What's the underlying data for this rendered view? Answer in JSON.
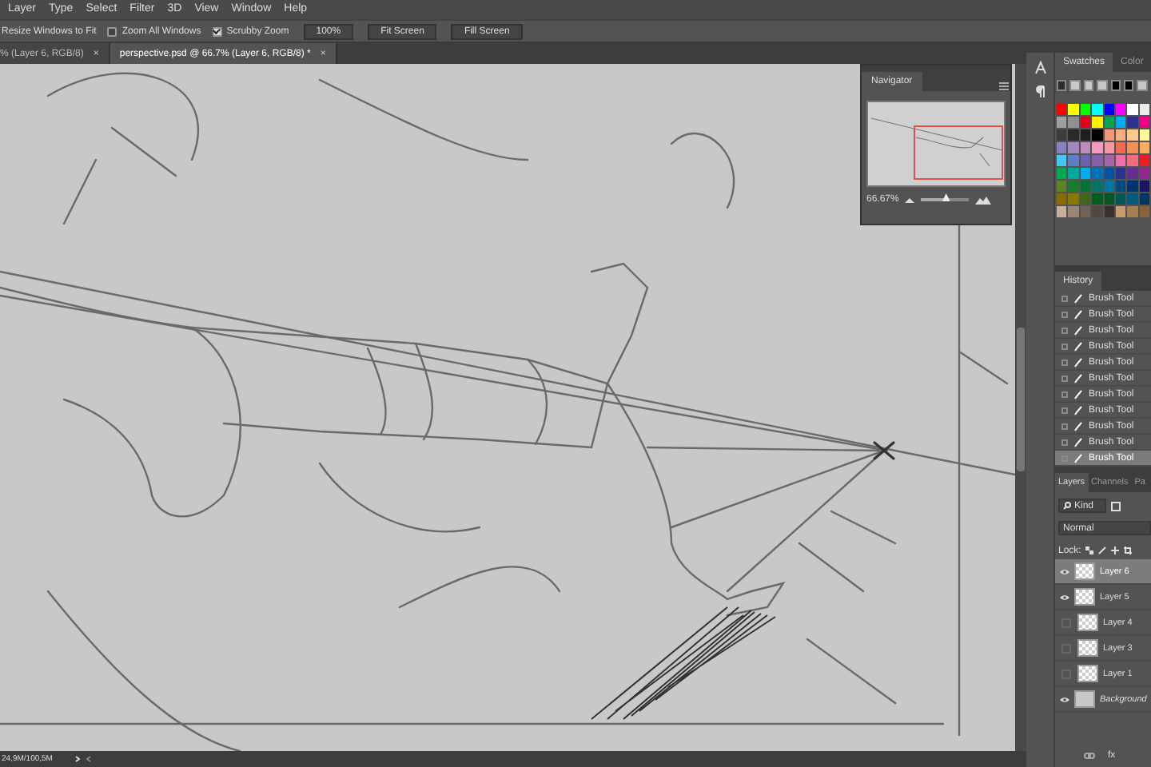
{
  "menu": [
    "Layer",
    "Type",
    "Select",
    "Filter",
    "3D",
    "View",
    "Window",
    "Help"
  ],
  "options": [
    {
      "kind": "label",
      "label": "Resize Windows to Fit"
    },
    {
      "kind": "checkbox",
      "label": "Zoom All Windows",
      "checked": false
    },
    {
      "kind": "checkbox",
      "label": "Scrubby Zoom",
      "checked": true
    },
    {
      "kind": "button",
      "label": "100%"
    },
    {
      "kind": "button",
      "label": "Fit Screen"
    },
    {
      "kind": "button",
      "label": "Fill Screen"
    }
  ],
  "tabs": [
    {
      "label": "% (Layer 6, RGB/8)",
      "close": "×",
      "selected": false
    },
    {
      "label": "perspective.psd @ 66.7% (Layer 6, RGB/8) *",
      "close": "×",
      "selected": true
    }
  ],
  "navigator": {
    "title": "Navigator",
    "zoom": "66.67%",
    "level": 0.5
  },
  "swatches": {
    "tabs": [
      {
        "label": "Swatches",
        "selected": true
      },
      {
        "label": "Color",
        "selected": false
      }
    ],
    "recent": [
      {
        "color": "#2b2b2b"
      },
      {
        "color": "#c8c8c8"
      },
      {
        "color": "#c8c8c8"
      },
      {
        "color": "#c8c8c8"
      },
      {
        "color": "#000000"
      },
      {
        "color": "#000000"
      },
      {
        "color": "#c8c8c8"
      }
    ],
    "grid": [
      [
        {
          "color": "#ff0000"
        },
        {
          "color": "#ffff00"
        },
        {
          "color": "#00ff00"
        },
        {
          "color": "#00ffff"
        },
        {
          "color": "#0000ff"
        },
        {
          "color": "#ff00ff"
        },
        {
          "color": "#ffffff"
        },
        {
          "color": "#ebebeb"
        }
      ],
      [
        {
          "color": "#a0a0a0"
        },
        {
          "color": "#909090"
        },
        {
          "color": "#e2001a"
        },
        {
          "color": "#fff200"
        },
        {
          "color": "#00a651"
        },
        {
          "color": "#00aeef"
        },
        {
          "color": "#2e3192"
        },
        {
          "color": "#ec008c"
        }
      ],
      [
        {
          "color": "#3c3c3c"
        },
        {
          "color": "#2a2a2a"
        },
        {
          "color": "#1e1e1e"
        },
        {
          "color": "#000000"
        },
        {
          "color": "#f7977a"
        },
        {
          "color": "#fbad82"
        },
        {
          "color": "#fdc68c"
        },
        {
          "color": "#fff799"
        }
      ],
      [
        {
          "color": "#8781bd"
        },
        {
          "color": "#a187be"
        },
        {
          "color": "#bc8cbf"
        },
        {
          "color": "#f49ac1"
        },
        {
          "color": "#f6989d"
        },
        {
          "color": "#f26c4f"
        },
        {
          "color": "#f68e56"
        },
        {
          "color": "#fbaf5d"
        }
      ],
      [
        {
          "color": "#44c8f5"
        },
        {
          "color": "#5b7fc2"
        },
        {
          "color": "#6c63b0"
        },
        {
          "color": "#8560a8"
        },
        {
          "color": "#a864a8"
        },
        {
          "color": "#f06eaa"
        },
        {
          "color": "#f26d7d"
        },
        {
          "color": "#ed1c24"
        }
      ],
      [
        {
          "color": "#00a651"
        },
        {
          "color": "#00a99d"
        },
        {
          "color": "#00aeef"
        },
        {
          "color": "#0072bc"
        },
        {
          "color": "#0054a6"
        },
        {
          "color": "#2e3192"
        },
        {
          "color": "#662d91"
        },
        {
          "color": "#92278f"
        }
      ],
      [
        {
          "color": "#598527"
        },
        {
          "color": "#197b30"
        },
        {
          "color": "#007236"
        },
        {
          "color": "#00746b"
        },
        {
          "color": "#0076a3"
        },
        {
          "color": "#004a80"
        },
        {
          "color": "#003471"
        },
        {
          "color": "#1b1464"
        }
      ],
      [
        {
          "color": "#8a6b00"
        },
        {
          "color": "#827b00"
        },
        {
          "color": "#406618"
        },
        {
          "color": "#005e20"
        },
        {
          "color": "#005826"
        },
        {
          "color": "#005952"
        },
        {
          "color": "#005b7f"
        },
        {
          "color": "#003663"
        }
      ],
      [
        {
          "color": "#c7b299"
        },
        {
          "color": "#998675"
        },
        {
          "color": "#736357"
        },
        {
          "color": "#534741"
        },
        {
          "color": "#362f2d"
        },
        {
          "color": "#c69c6d"
        },
        {
          "color": "#a67c52"
        },
        {
          "color": "#8c6239"
        }
      ]
    ]
  },
  "history": {
    "title": "History",
    "items": [
      {
        "label": "Brush Tool",
        "selected": false
      },
      {
        "label": "Brush Tool",
        "selected": false
      },
      {
        "label": "Brush Tool",
        "selected": false
      },
      {
        "label": "Brush Tool",
        "selected": false
      },
      {
        "label": "Brush Tool",
        "selected": false
      },
      {
        "label": "Brush Tool",
        "selected": false
      },
      {
        "label": "Brush Tool",
        "selected": false
      },
      {
        "label": "Brush Tool",
        "selected": false
      },
      {
        "label": "Brush Tool",
        "selected": false
      },
      {
        "label": "Brush Tool",
        "selected": false
      },
      {
        "label": "Brush Tool",
        "selected": true
      }
    ]
  },
  "layers": {
    "tabs": [
      {
        "label": "Layers",
        "selected": true
      },
      {
        "label": "Channels",
        "selected": false
      },
      {
        "label": "Pa",
        "selected": false
      }
    ],
    "filter": "Kind",
    "blend_mode": "Normal",
    "lock_label": "Lock:",
    "fx": "fx",
    "items": [
      {
        "name": "Layer 6",
        "visible": true,
        "selected": true,
        "kind": "transparent"
      },
      {
        "name": "Layer 5",
        "visible": true,
        "selected": false,
        "kind": "transparent"
      },
      {
        "name": "Layer 4",
        "visible": false,
        "selected": false,
        "kind": "transparent"
      },
      {
        "name": "Layer 3",
        "visible": false,
        "selected": false,
        "kind": "transparent"
      },
      {
        "name": "Layer 1",
        "visible": false,
        "selected": false,
        "kind": "transparent"
      },
      {
        "name": "Background",
        "visible": true,
        "selected": false,
        "kind": "background"
      }
    ]
  },
  "status": "24,9M/100,5M"
}
